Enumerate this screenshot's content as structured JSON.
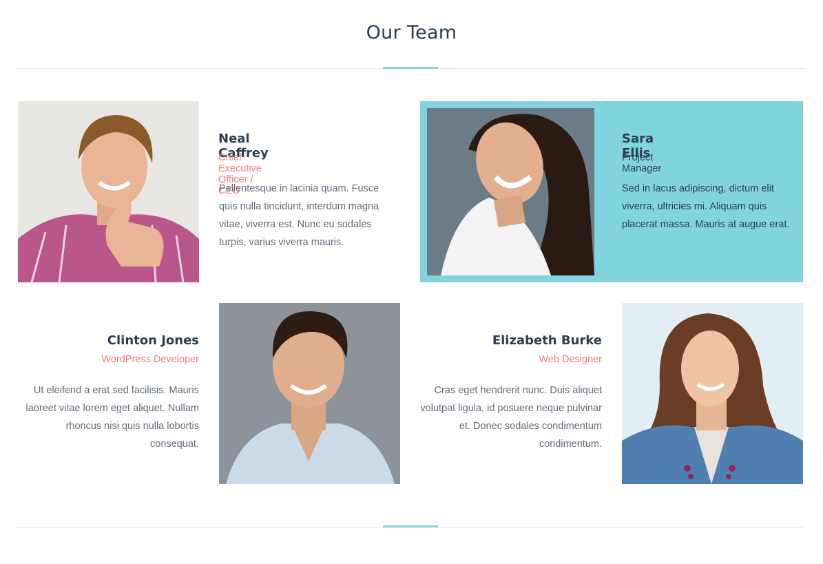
{
  "section": {
    "title": "Our Team"
  },
  "colors": {
    "accent": "#81d3de",
    "role_pink": "#f07c7c",
    "name_dark": "#2c3e50",
    "highlight_bg": "#81d3de"
  },
  "members": [
    {
      "name": "Neal Caffrey",
      "role": "Chief Executive Officer / CEO",
      "bio": "Pellentesque in lacinia quam. Fusce quis nulla tincidunt, interdum magna vitae, viverra est. Nunc eu sodales turpis, varius viverra mauris.",
      "photo_icon": "man-thumbs-up-photo",
      "highlighted": false
    },
    {
      "name": "Sara Ellis",
      "role": "Project Manager",
      "bio": " Sed in lacus adipiscing, dictum elit viverra, ultricies mi. Aliquam quis placerat massa. Mauris at augue erat.",
      "photo_icon": "woman-smiling-photo",
      "highlighted": true
    },
    {
      "name": "Clinton Jones",
      "role": "WordPress Developer",
      "bio": "Ut eleifend a erat sed facilisis. Mauris laoreet vitae lorem eget aliquet. Nullam rhoncus nisi quis nulla lobortis consequat.",
      "photo_icon": "man-smiling-photo",
      "highlighted": false
    },
    {
      "name": "Elizabeth Burke",
      "role": "Web Designer",
      "bio": "Cras eget hendrerit nunc. Duis aliquet volutpat ligula, id posuere neque pulvinar et. Donec sodales condimentum condimentum.",
      "photo_icon": "woman-portrait-photo",
      "highlighted": false
    }
  ]
}
